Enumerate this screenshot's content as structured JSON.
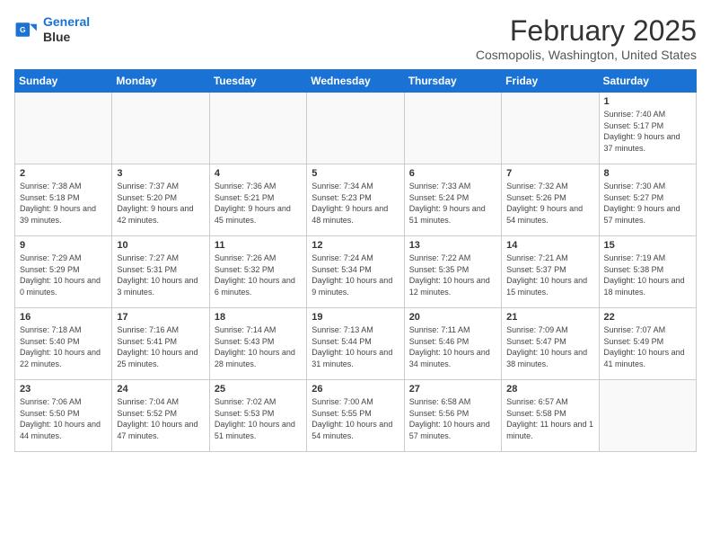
{
  "logo": {
    "line1": "General",
    "line2": "Blue"
  },
  "title": "February 2025",
  "subtitle": "Cosmopolis, Washington, United States",
  "weekdays": [
    "Sunday",
    "Monday",
    "Tuesday",
    "Wednesday",
    "Thursday",
    "Friday",
    "Saturday"
  ],
  "weeks": [
    [
      {
        "day": "",
        "info": ""
      },
      {
        "day": "",
        "info": ""
      },
      {
        "day": "",
        "info": ""
      },
      {
        "day": "",
        "info": ""
      },
      {
        "day": "",
        "info": ""
      },
      {
        "day": "",
        "info": ""
      },
      {
        "day": "1",
        "info": "Sunrise: 7:40 AM\nSunset: 5:17 PM\nDaylight: 9 hours and 37 minutes."
      }
    ],
    [
      {
        "day": "2",
        "info": "Sunrise: 7:38 AM\nSunset: 5:18 PM\nDaylight: 9 hours and 39 minutes."
      },
      {
        "day": "3",
        "info": "Sunrise: 7:37 AM\nSunset: 5:20 PM\nDaylight: 9 hours and 42 minutes."
      },
      {
        "day": "4",
        "info": "Sunrise: 7:36 AM\nSunset: 5:21 PM\nDaylight: 9 hours and 45 minutes."
      },
      {
        "day": "5",
        "info": "Sunrise: 7:34 AM\nSunset: 5:23 PM\nDaylight: 9 hours and 48 minutes."
      },
      {
        "day": "6",
        "info": "Sunrise: 7:33 AM\nSunset: 5:24 PM\nDaylight: 9 hours and 51 minutes."
      },
      {
        "day": "7",
        "info": "Sunrise: 7:32 AM\nSunset: 5:26 PM\nDaylight: 9 hours and 54 minutes."
      },
      {
        "day": "8",
        "info": "Sunrise: 7:30 AM\nSunset: 5:27 PM\nDaylight: 9 hours and 57 minutes."
      }
    ],
    [
      {
        "day": "9",
        "info": "Sunrise: 7:29 AM\nSunset: 5:29 PM\nDaylight: 10 hours and 0 minutes."
      },
      {
        "day": "10",
        "info": "Sunrise: 7:27 AM\nSunset: 5:31 PM\nDaylight: 10 hours and 3 minutes."
      },
      {
        "day": "11",
        "info": "Sunrise: 7:26 AM\nSunset: 5:32 PM\nDaylight: 10 hours and 6 minutes."
      },
      {
        "day": "12",
        "info": "Sunrise: 7:24 AM\nSunset: 5:34 PM\nDaylight: 10 hours and 9 minutes."
      },
      {
        "day": "13",
        "info": "Sunrise: 7:22 AM\nSunset: 5:35 PM\nDaylight: 10 hours and 12 minutes."
      },
      {
        "day": "14",
        "info": "Sunrise: 7:21 AM\nSunset: 5:37 PM\nDaylight: 10 hours and 15 minutes."
      },
      {
        "day": "15",
        "info": "Sunrise: 7:19 AM\nSunset: 5:38 PM\nDaylight: 10 hours and 18 minutes."
      }
    ],
    [
      {
        "day": "16",
        "info": "Sunrise: 7:18 AM\nSunset: 5:40 PM\nDaylight: 10 hours and 22 minutes."
      },
      {
        "day": "17",
        "info": "Sunrise: 7:16 AM\nSunset: 5:41 PM\nDaylight: 10 hours and 25 minutes."
      },
      {
        "day": "18",
        "info": "Sunrise: 7:14 AM\nSunset: 5:43 PM\nDaylight: 10 hours and 28 minutes."
      },
      {
        "day": "19",
        "info": "Sunrise: 7:13 AM\nSunset: 5:44 PM\nDaylight: 10 hours and 31 minutes."
      },
      {
        "day": "20",
        "info": "Sunrise: 7:11 AM\nSunset: 5:46 PM\nDaylight: 10 hours and 34 minutes."
      },
      {
        "day": "21",
        "info": "Sunrise: 7:09 AM\nSunset: 5:47 PM\nDaylight: 10 hours and 38 minutes."
      },
      {
        "day": "22",
        "info": "Sunrise: 7:07 AM\nSunset: 5:49 PM\nDaylight: 10 hours and 41 minutes."
      }
    ],
    [
      {
        "day": "23",
        "info": "Sunrise: 7:06 AM\nSunset: 5:50 PM\nDaylight: 10 hours and 44 minutes."
      },
      {
        "day": "24",
        "info": "Sunrise: 7:04 AM\nSunset: 5:52 PM\nDaylight: 10 hours and 47 minutes."
      },
      {
        "day": "25",
        "info": "Sunrise: 7:02 AM\nSunset: 5:53 PM\nDaylight: 10 hours and 51 minutes."
      },
      {
        "day": "26",
        "info": "Sunrise: 7:00 AM\nSunset: 5:55 PM\nDaylight: 10 hours and 54 minutes."
      },
      {
        "day": "27",
        "info": "Sunrise: 6:58 AM\nSunset: 5:56 PM\nDaylight: 10 hours and 57 minutes."
      },
      {
        "day": "28",
        "info": "Sunrise: 6:57 AM\nSunset: 5:58 PM\nDaylight: 11 hours and 1 minute."
      },
      {
        "day": "",
        "info": ""
      }
    ]
  ]
}
